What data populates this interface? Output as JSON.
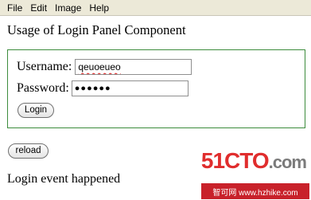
{
  "menu": {
    "items": [
      "File",
      "Edit",
      "Image",
      "Help"
    ]
  },
  "page": {
    "title": "Usage of Login Panel Component",
    "event_text": "Login event happened"
  },
  "login_panel": {
    "username_label": "Username:",
    "username_value": "qeuoeueo",
    "password_label": "Password:",
    "password_value": "●●●●●●",
    "login_button": "Login"
  },
  "reload_button": "reload",
  "watermark": {
    "logo": "51CTO",
    "logo_suffix": ".com",
    "strip": "智可网  www.hzhike.com"
  },
  "colors": {
    "panel_border": "#3c8c3c",
    "menubar_bg": "#ece9d8",
    "watermark_red": "#c8212a"
  }
}
